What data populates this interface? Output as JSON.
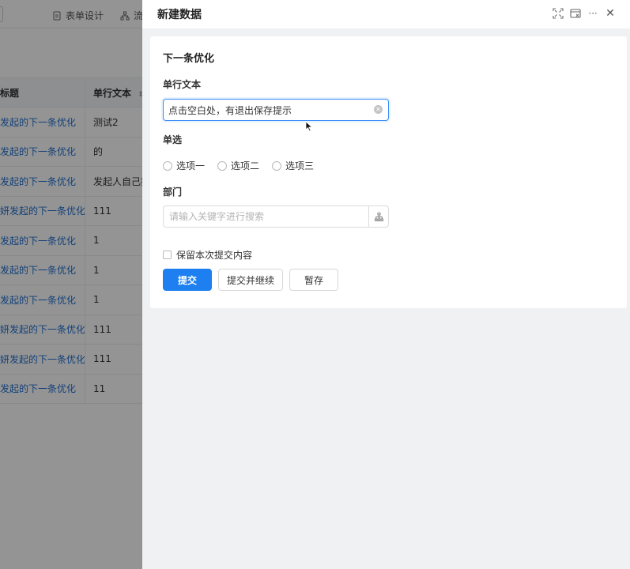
{
  "background": {
    "tabs": [
      {
        "icon": "file-icon",
        "label": "表单设计"
      },
      {
        "icon": "flow-icon",
        "label": "流"
      }
    ],
    "table": {
      "headers": [
        "标题",
        "单行文本"
      ],
      "rows": [
        [
          "发起的下一条优化",
          "测试2"
        ],
        [
          "发起的下一条优化",
          "的"
        ],
        [
          "发起的下一条优化",
          "发起人自己撤"
        ],
        [
          "妍发起的下一条优化",
          "111"
        ],
        [
          "发起的下一条优化",
          "1"
        ],
        [
          "发起的下一条优化",
          "1"
        ],
        [
          "发起的下一条优化",
          "1"
        ],
        [
          "妍发起的下一条优化",
          "111"
        ],
        [
          "妍发起的下一条优化",
          "111"
        ],
        [
          "发起的下一条优化",
          "11"
        ]
      ]
    }
  },
  "drawer": {
    "title": "新建数据",
    "header_icons": [
      "fullscreen-icon",
      "window-icon",
      "more-icon",
      "close-icon"
    ],
    "more_glyph": "···",
    "close_glyph": "✕",
    "form_title": "下一条优化",
    "fields": {
      "text_label": "单行文本",
      "text_value": "点击空白处，有退出保存提示",
      "radio_label": "单选",
      "radio_options": [
        "选项一",
        "选项二",
        "选项三"
      ],
      "dept_label": "部门",
      "dept_placeholder": "请输入关键字进行搜索"
    },
    "keep_label": "保留本次提交内容",
    "buttons": {
      "submit": "提交",
      "submit_continue": "提交并继续",
      "draft": "暂存"
    }
  }
}
